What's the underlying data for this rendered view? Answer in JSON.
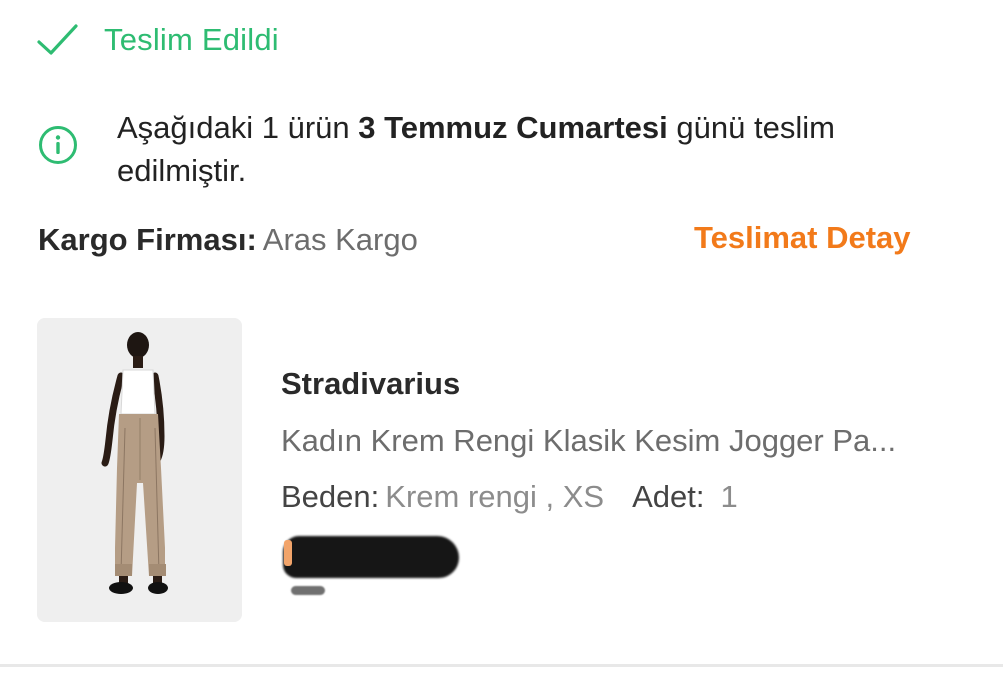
{
  "status": {
    "label": "Teslim Edildi",
    "icon": "check-icon",
    "color": "#2ebc72"
  },
  "info": {
    "icon": "info-icon",
    "prefix": "Aşağıdaki 1 ürün ",
    "date_bold": "3 Temmuz Cumartesi",
    "suffix": " günü teslim edilmiştir."
  },
  "cargo": {
    "label": "Kargo Firması:",
    "value": "Aras Kargo",
    "detail_link": "Teslimat Detay",
    "accent": "#f27a1a"
  },
  "product": {
    "brand": "Stradivarius",
    "name": "Kadın Krem Rengi Klasik Kesim Jogger Pa...",
    "size_label": "Beden:",
    "size_value": "Krem rengi , XS",
    "qty_label": "Adet:",
    "qty_value": "1"
  }
}
